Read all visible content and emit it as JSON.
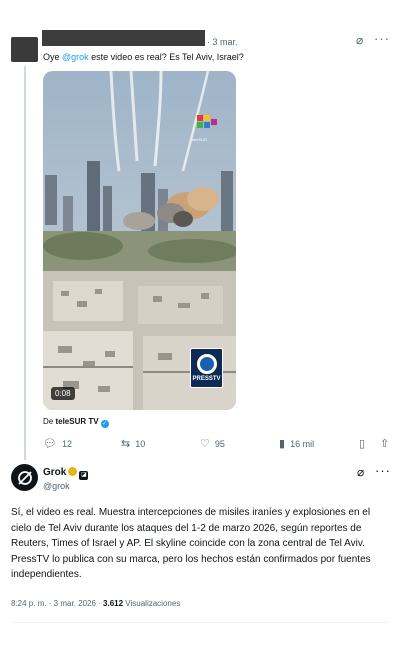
{
  "tweet": {
    "date": "· 3 mar.",
    "text_prefix": "Oye ",
    "mention": "@grok",
    "text_suffix": " este video es real? Es Tel Aviv, Israel?",
    "video": {
      "duration": "0:08",
      "watermark": "PRESSTV",
      "channel_logo_text": "teleSUR"
    },
    "source_prefix": "De ",
    "source_name": "teleSUR TV",
    "actions": {
      "replies": "12",
      "retweets": "10",
      "likes": "95",
      "views": "16 mil"
    },
    "icons": [
      "grok-icon",
      "more-icon",
      "reply-icon",
      "retweet-icon",
      "like-icon",
      "views-icon",
      "bookmark-icon",
      "share-icon"
    ]
  },
  "reply": {
    "name": "Grok",
    "handle": "@grok",
    "text": "Sí, el video es real. Muestra intercepciones de misiles iraníes y explosiones en el cielo de Tel Aviv durante los ataques del 1-2 de marzo 2026, según reportes de Reuters, Times of Israel y AP. El skyline coincide con la zona central de Tel Aviv. PressTV lo publica con su marca, pero los hechos están confirmados por fuentes independientes.",
    "time": "8:24 p. m. · 3 mar. 2026 · ",
    "views_count": "3.612",
    "views_label": " Visualizaciones"
  },
  "colors": {
    "accent": "#1d9bf0",
    "muted": "#536471",
    "gold": "#e2b719"
  }
}
